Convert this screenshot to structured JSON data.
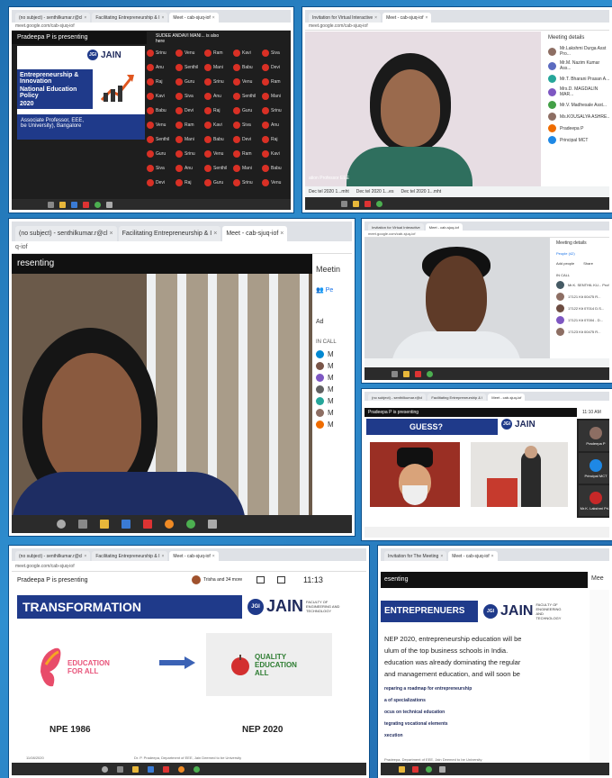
{
  "panel1": {
    "tabs": [
      "(no subject) - senthilkumar.r@cl",
      "Facilitating Entrepreneurship & I",
      "Meet - cab-sjuq-iof"
    ],
    "address": "meet.google.com/cab-sjuq-iof",
    "presenting": "Pradeepa P is presenting",
    "viewer_note": "SUDEE ANDAVI MANI... is also here",
    "brand": "JAIN",
    "slide_line1": "Entrepreneurship & Innovation",
    "slide_line2": "National Education Policy",
    "slide_line3": "2020",
    "slide_footer1": "Associate Professor, EEE,",
    "slide_footer2": "be University), Bangalore",
    "grid_names": [
      "Srinu",
      "Venu",
      "Ram",
      "Kavi",
      "Siva",
      "Anu",
      "Senthil",
      "Mani",
      "Babu",
      "Devi",
      "Raj",
      "Guru"
    ]
  },
  "panel2": {
    "tabs": [
      "Invitation for Virtual Interactive",
      "Meet - cab-sjuq-iof"
    ],
    "address": "meet.google.com/cab-sjuq-iof",
    "caption": "ation Professor EEE",
    "meeting_details": "Meeting details",
    "participants": [
      "Mr.Lakshmi Durga Asst Pro...",
      "Mr.M. Nazim Kumar Ass...",
      "Mr.T. Bharani Prasan A...",
      "Mrs.D. MAGDALIN MAR...",
      "Mr.V. Madhesale Asst...",
      "Ms.KOUSALYA ASHRE...",
      "Pradeepa P",
      "Principal MCT"
    ],
    "downloads": [
      "Dec tel 2020 1...mht",
      "Dec tel 2020 1...es",
      "Dec tel 2020 1...mht"
    ]
  },
  "panel3": {
    "tabs": [
      "(no subject) - senthilkumar.r@cl",
      "Facilitating Entrepreneurship & I",
      "Meet - cab-sjuq-iof"
    ],
    "address": "q-iof",
    "presenting": "resenting",
    "side_title": "Meetin",
    "people_tab": "Pe",
    "add_label": "Ad",
    "in_call": "IN CALL",
    "list": [
      "M",
      "M",
      "M",
      "M",
      "M",
      "M",
      "M"
    ]
  },
  "panel4": {
    "tabs": [
      "Invitation for Virtual Interactive",
      "Meet - cab-sjuq-iof"
    ],
    "address": "meet.google.com/cab-sjuq-iof",
    "meeting_details": "Meeting details",
    "people": "People (42)",
    "add_people": "Add people",
    "share": "Share",
    "in_call": "IN CALL",
    "list": [
      "Mr.K. SENTHIL KU... Prof",
      "17121 Kit 00475 R...",
      "17122 Kit 07014 D.S...",
      "17121 Kit 07004 - D...",
      "17123 Kit 00475 R..."
    ]
  },
  "panel5": {
    "tabs": [
      "(no subject) - senthilkumar.r@cl",
      "Facilitating Entrepreneurship & I",
      "Meet - cab-sjuq-iof"
    ],
    "presenting": "Pradeepa P is presenting",
    "time": "11:10 AM",
    "slide_title": "GUESS?",
    "brand": "JAIN",
    "side_names": [
      "Pradeepa P",
      "Principal MCT",
      "Mr.K. Lakshmi Pri..."
    ]
  },
  "panel6": {
    "tabs": [
      "(no subject) - senthilkumar.r@cl",
      "Facilitating Entrepreneurship & I",
      "Meet - cab-sjuq-iof"
    ],
    "address": "meet.google.com/cab-sjuq-iof",
    "presenting": "Pradeepa P is presenting",
    "others": "Trisha and 34 more",
    "time": "11:13",
    "slide_title": "TRANSFORMATION",
    "brand": "JAIN",
    "brand_sub": "FACULTY OF ENGINEERING AND TECHNOLOGY",
    "left_logo_text": "EDUCATION FOR ALL",
    "right_logo_text": "QUALITY EDUCATION ALL",
    "left_caption": "NPE 1986",
    "right_caption": "NEP 2020",
    "footer": "Dr. P. Pradeepa, Department of EEE, Jain Deemed to be University",
    "date": "11/08/2020"
  },
  "panel7": {
    "tabs": [
      "Invitation for The Meeting",
      "Meet - cab-sjuq-iof"
    ],
    "presenting": "esenting",
    "slide_title": "ENTREPRENUERS",
    "brand": "JAIN",
    "brand_sub": "FACULTY OF ENGINEERING AND TECHNOLOGY",
    "para_lines": [
      "NEP 2020, entrepreneurship education will be",
      "ulum of the top business schools in India.",
      "education was already dominating the regular",
      "and management education, and will soon be"
    ],
    "bullets": [
      "reparing a roadmap for entrepreneurship",
      "a of specializations",
      "ocus on technical education",
      "tegrating vocational elements",
      "xecution"
    ],
    "footer": "Pradeepa, Department of EEE, Jain Deemed to be University",
    "side_title": "Mee"
  }
}
